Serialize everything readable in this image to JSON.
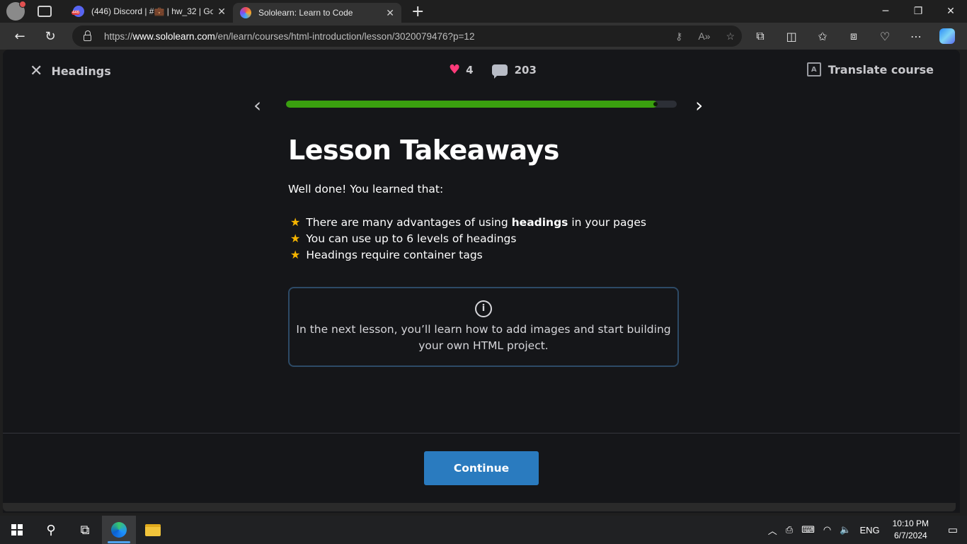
{
  "browser": {
    "tabs": [
      {
        "title": "(446) Discord | #💼 | hw_32 | Goa",
        "active": false
      },
      {
        "title": "Sololearn: Learn to Code",
        "active": true
      }
    ],
    "url_prefix": "https://",
    "url_host": "www.sololearn.com",
    "url_path": "/en/learn/courses/html-introduction/lesson/3020079476?p=12"
  },
  "lesson": {
    "close_label": "Headings",
    "hearts": "4",
    "comments": "203",
    "translate_label": "Translate course",
    "progress_fraction": 0.95,
    "title": "Lesson Takeaways",
    "intro": "Well done! You learned that:",
    "takeaways": [
      {
        "pre": "There are many advantages of using ",
        "bold": "headings",
        "post": " in your pages"
      },
      {
        "pre": "You can use up to 6 levels of headings",
        "bold": "",
        "post": ""
      },
      {
        "pre": "Headings require container tags",
        "bold": "",
        "post": ""
      }
    ],
    "info_line1": "In the next lesson, you’ll learn how to add images and start building",
    "info_line2": "your own HTML project.",
    "continue_label": "Continue"
  },
  "taskbar": {
    "language": "ENG",
    "time": "10:10 PM",
    "date": "6/7/2024"
  },
  "colors": {
    "progress": "#3aa00f",
    "continue_button": "#2a7bbf",
    "heart": "#ff3b7a",
    "star": "#f5b400"
  }
}
